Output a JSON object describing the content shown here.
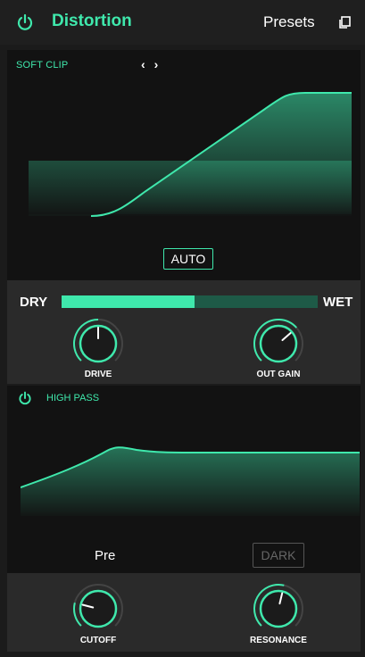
{
  "header": {
    "title": "Distortion",
    "presets_label": "Presets",
    "power_icon": "power-icon",
    "copy_icon": "copy-icon"
  },
  "clip": {
    "mode_label": "SOFT CLIP",
    "prev_label": "‹",
    "next_label": "›",
    "auto_label": "AUTO"
  },
  "mix": {
    "dry_label": "DRY",
    "wet_label": "WET",
    "level": 0.52
  },
  "knobs": {
    "drive": {
      "label": "DRIVE",
      "value": 0.5
    },
    "out_gain": {
      "label": "OUT GAIN",
      "value": 0.68
    },
    "cutoff": {
      "label": "CUTOFF",
      "value": 0.22
    },
    "resonance": {
      "label": "RESONANCE",
      "value": 0.55
    }
  },
  "highpass": {
    "label": "HIGH PASS",
    "pre_label": "Pre",
    "dark_label": "DARK"
  },
  "colors": {
    "accent": "#3fe8ac",
    "accent_dark": "#1e5a47",
    "panel": "#121212",
    "surface": "#2a2a2a"
  }
}
